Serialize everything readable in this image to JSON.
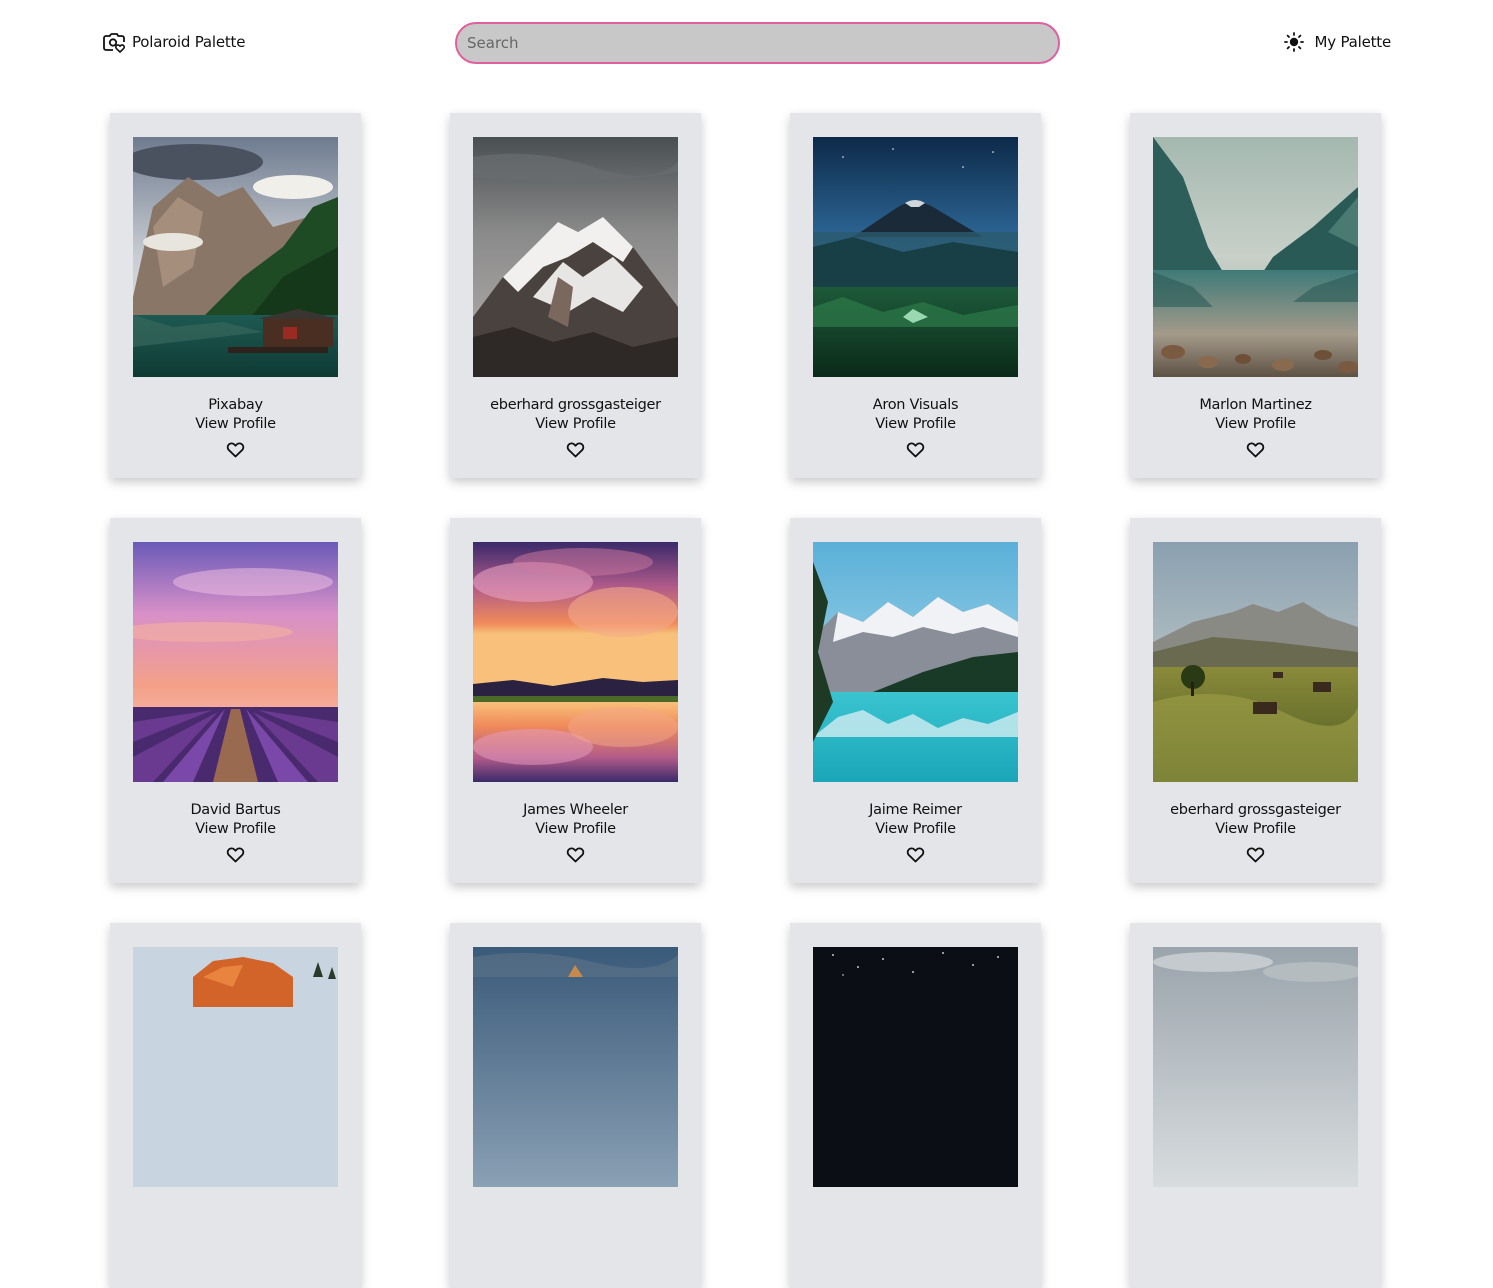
{
  "header": {
    "brand_label": "Polaroid Palette",
    "brand_icon": "camera-heart-icon",
    "search_placeholder": "Search",
    "search_value": "",
    "palette_label": "My Palette",
    "palette_icon": "sun-icon",
    "search_border_color": "#e0609e"
  },
  "cards": [
    {
      "author": "Pixabay",
      "link": "View Profile",
      "image": "mountain-lake-cabin"
    },
    {
      "author": "eberhard grossgasteiger",
      "link": "View Profile",
      "image": "snowy-mountain"
    },
    {
      "author": "Aron Visuals",
      "link": "View Profile",
      "image": "night-volcano-valley"
    },
    {
      "author": "Marlon Martinez",
      "link": "View Profile",
      "image": "misty-lake-reflection"
    },
    {
      "author": "David Bartus",
      "link": "View Profile",
      "image": "lavender-field-sunset"
    },
    {
      "author": "James Wheeler",
      "link": "View Profile",
      "image": "cloud-sunset-reflection"
    },
    {
      "author": "Jaime Reimer",
      "link": "View Profile",
      "image": "turquoise-lake-mountains"
    },
    {
      "author": "eberhard grossgasteiger",
      "link": "View Profile",
      "image": "alpine-meadow-huts"
    },
    {
      "author": "",
      "link": "",
      "image": "desert-rock-sunset"
    },
    {
      "author": "",
      "link": "",
      "image": "cloudy-peak"
    },
    {
      "author": "",
      "link": "",
      "image": "starry-sky"
    },
    {
      "author": "",
      "link": "",
      "image": "overcast-sky"
    }
  ]
}
